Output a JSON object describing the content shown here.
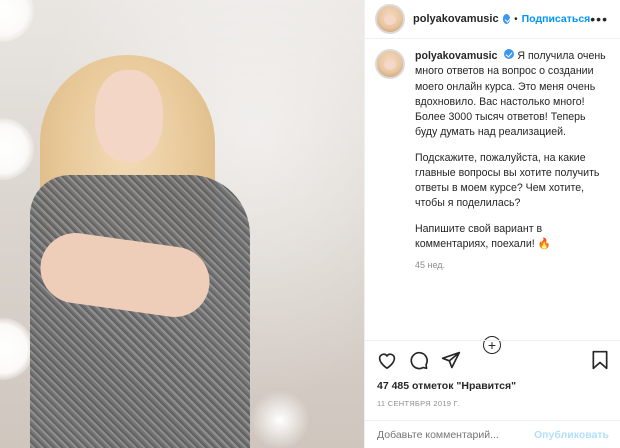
{
  "post": {
    "username": "polyakovamusic",
    "separator": "•",
    "follow_label": "Подписаться",
    "more_icon": "more-icon",
    "caption": {
      "p1": "Я получила очень много ответов на вопрос о создании моего онлайн курса. Это меня очень вдохновило. Вас настолько много! Более 3000 тысяч ответов! Теперь буду думать над реализацией.",
      "p2": "Подскажите, пожалуйста, на какие главные вопросы вы хотите получить ответы в моем курсе? Чем хотите, чтобы я поделилась?",
      "p3": "Напишите свой вариант в комментариях, поехали! 🔥"
    },
    "age": "45 нед.",
    "likes": "47 485 отметок \"Нравится\"",
    "date": "11 СЕНТЯБРЯ 2019 Г.",
    "comment_placeholder": "Добавьте комментарий...",
    "publish_label": "Опубликовать"
  },
  "colors": {
    "accent": "#0095f6",
    "verified": "#3897f0",
    "muted": "#8e8e8e",
    "publish_disabled": "#b2dffc"
  }
}
